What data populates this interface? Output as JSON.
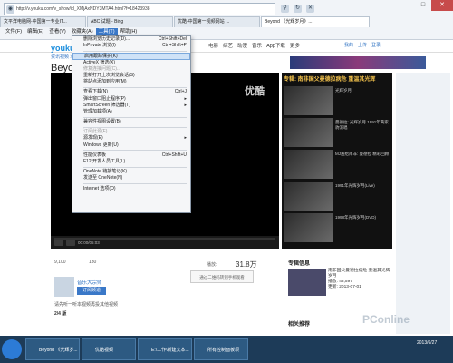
{
  "browser": {
    "address": "http://v.youku.com/v_show/id_XMjAxNDY3MTA4.html?f=18423938",
    "tabs": [
      "文平洋电脑网-中国第一专业IT...",
      "ABC 试题 - Bing",
      "优酷-中国第一视频网站 ...",
      "Beyond 《光辉岁月》..."
    ],
    "active_tab": 3,
    "menubar": [
      "文件(F)",
      "编辑(E)",
      "查看(V)",
      "收藏夹(A)",
      "工具(T)",
      "帮助(H)"
    ],
    "open_menu": "工具(T)"
  },
  "tools_menu": [
    {
      "label": "删除浏览历史记录(D)...",
      "shortcut": "Ctrl+Shift+Del"
    },
    {
      "label": "InPrivate 浏览(I)",
      "shortcut": "Ctrl+Shift+P"
    },
    {
      "sep": true
    },
    {
      "label": "启用跟踪保护(K)",
      "shortcut": "",
      "highlight": true
    },
    {
      "label": "ActiveX 筛选(X)",
      "shortcut": ""
    },
    {
      "label": "修复连接问题(C)...",
      "shortcut": "",
      "disabled": true
    },
    {
      "label": "重新打开上次浏览会话(S)",
      "shortcut": ""
    },
    {
      "label": "将站点添加到应用(M)",
      "shortcut": ""
    },
    {
      "sep": true
    },
    {
      "label": "查看下载(N)",
      "shortcut": "Ctrl+J"
    },
    {
      "label": "弹出窗口阻止程序(P)",
      "shortcut": "▸"
    },
    {
      "label": "SmartScreen 筛选器(T)",
      "shortcut": "▸"
    },
    {
      "label": "管理加载项(A)",
      "shortcut": ""
    },
    {
      "sep": true
    },
    {
      "label": "兼容性视图设置(B)",
      "shortcut": ""
    },
    {
      "sep": true
    },
    {
      "label": "订阅此源(F)...",
      "shortcut": "",
      "disabled": true
    },
    {
      "label": "源发现(E)",
      "shortcut": "▸"
    },
    {
      "label": "Windows 更新(U)",
      "shortcut": ""
    },
    {
      "sep": true
    },
    {
      "label": "性能仪表板",
      "shortcut": "Ctrl+Shift+U"
    },
    {
      "label": "F12 开发人员工具(L)",
      "shortcut": ""
    },
    {
      "sep": true
    },
    {
      "label": "OneNote 链接笔记(K)",
      "shortcut": ""
    },
    {
      "label": "发送至 OneNote(N)",
      "shortcut": ""
    },
    {
      "sep": true
    },
    {
      "label": "Internet 选项(O)",
      "shortcut": ""
    }
  ],
  "page": {
    "logo_a": "youku",
    "logo_b": "优酷",
    "nav_links": [
      "电影",
      "综艺",
      "动漫",
      "音乐",
      "App下载",
      "更多"
    ],
    "nav_right": [
      "我的",
      "上传",
      "登录"
    ],
    "breadcrumb": "资讯视频 > Beyond",
    "video_title": "Beyond 《光辉岁月》",
    "watermark": "优酷",
    "player_time": "00:00/05:03",
    "progress_pct": 0,
    "sidebar_heading": "专辑: 南非国父曼德拉病危 重温其光辉",
    "sidebar_items": [
      "光辉岁月",
      "曼德拉: 光辉岁月 1991年黄家驹演唱",
      "MJ送给南非: 曼德拉 精彩回顾",
      "1991年光辉岁月(Live)",
      "1998年光辉岁月(DVD)"
    ],
    "likes": "9,100",
    "dislikes": "130",
    "play_count_label": "播放:",
    "play_count": "31.8万",
    "toast_text": "通过二维码转到手机观看",
    "channel_name": "音乐大宗师",
    "subscribe_label": "订阅频道",
    "desc": "请先听一听本视频再投其他视频",
    "page_count": "2/4 版",
    "panel_title": "专辑信息",
    "panel_text": "南非国父曼德拉病危 重温其光辉岁月",
    "panel_views": "播放: 43,597",
    "panel_time": "更新: 2013-07-01",
    "related_title": "相关推荐",
    "site_watermark": "PConline"
  },
  "taskbar": {
    "items": [
      "Beyond 《光辉岁...",
      "优酷视频",
      "E:\\工作\\新建文本...",
      "所有控制面板项"
    ],
    "clock": "2013/6/27"
  },
  "colors": {
    "accent": "#3a78c8",
    "youku_red": "#e04848",
    "youku_blue": "#1d8fde",
    "sidebar_head": "#f3c24c"
  }
}
